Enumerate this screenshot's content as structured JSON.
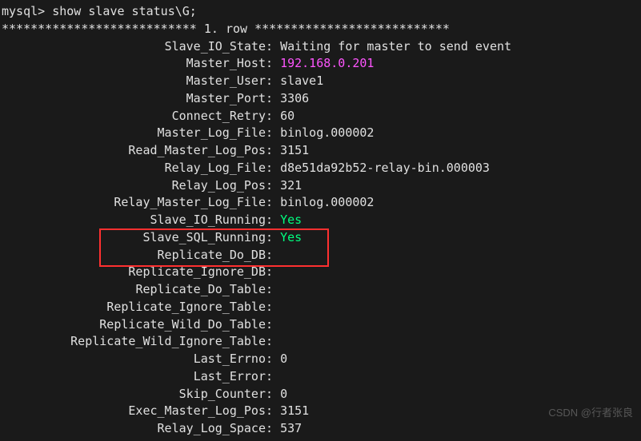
{
  "prompt": "mysql> show slave status\\G;",
  "row_header": "*************************** 1. row ***************************",
  "fields": [
    {
      "label": "Slave_IO_State",
      "value": "Waiting for master to send event",
      "cls": ""
    },
    {
      "label": "Master_Host",
      "value": "192.168.0.201",
      "cls": "magenta"
    },
    {
      "label": "Master_User",
      "value": "slave1",
      "cls": ""
    },
    {
      "label": "Master_Port",
      "value": "3306",
      "cls": ""
    },
    {
      "label": "Connect_Retry",
      "value": "60",
      "cls": ""
    },
    {
      "label": "Master_Log_File",
      "value": "binlog.000002",
      "cls": ""
    },
    {
      "label": "Read_Master_Log_Pos",
      "value": "3151",
      "cls": ""
    },
    {
      "label": "Relay_Log_File",
      "value": "d8e51da92b52-relay-bin.000003",
      "cls": ""
    },
    {
      "label": "Relay_Log_Pos",
      "value": "321",
      "cls": ""
    },
    {
      "label": "Relay_Master_Log_File",
      "value": "binlog.000002",
      "cls": ""
    },
    {
      "label": "Slave_IO_Running",
      "value": "Yes",
      "cls": "green"
    },
    {
      "label": "Slave_SQL_Running",
      "value": "Yes",
      "cls": "green"
    },
    {
      "label": "Replicate_Do_DB",
      "value": "",
      "cls": ""
    },
    {
      "label": "Replicate_Ignore_DB",
      "value": "",
      "cls": ""
    },
    {
      "label": "Replicate_Do_Table",
      "value": "",
      "cls": ""
    },
    {
      "label": "Replicate_Ignore_Table",
      "value": "",
      "cls": ""
    },
    {
      "label": "Replicate_Wild_Do_Table",
      "value": "",
      "cls": ""
    },
    {
      "label": "Replicate_Wild_Ignore_Table",
      "value": "",
      "cls": ""
    },
    {
      "label": "Last_Errno",
      "value": "0",
      "cls": ""
    },
    {
      "label": "Last_Error",
      "value": "",
      "cls": ""
    },
    {
      "label": "Skip_Counter",
      "value": "0",
      "cls": ""
    },
    {
      "label": "Exec_Master_Log_Pos",
      "value": "3151",
      "cls": ""
    },
    {
      "label": "Relay_Log_Space",
      "value": "537",
      "cls": ""
    }
  ],
  "watermark": "CSDN @行者张良"
}
